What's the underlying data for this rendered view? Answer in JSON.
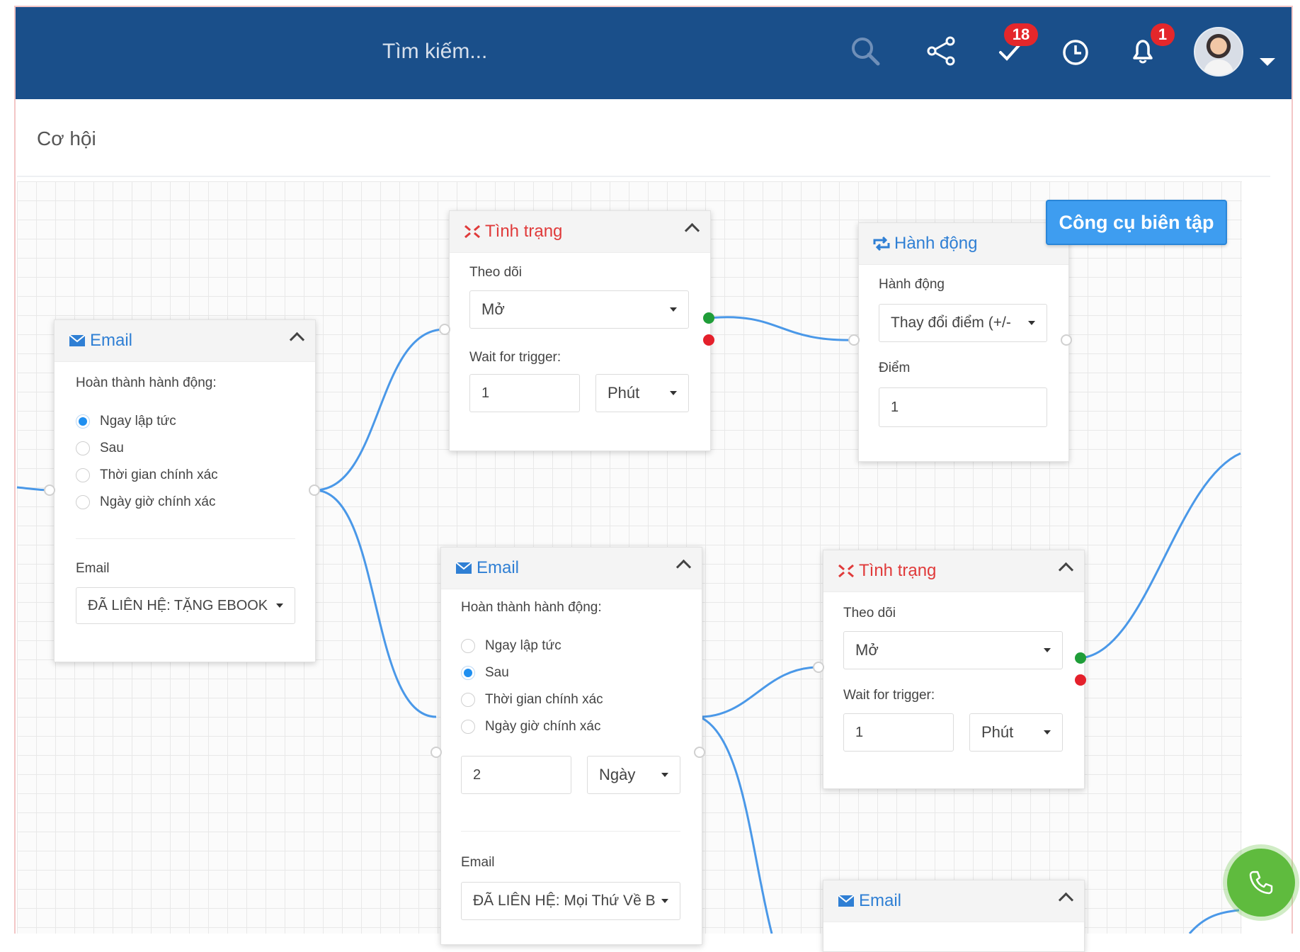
{
  "header": {
    "search_placeholder": "Tìm kiếm...",
    "tasks_badge": "18",
    "notifications_badge": "1",
    "bg_color": "#1a4f8a"
  },
  "page": {
    "title": "Cơ hội"
  },
  "toolbar": {
    "editor_button": "Công cụ biên tập"
  },
  "nodes": {
    "email1": {
      "title": "Email",
      "complete_label": "Hoàn thành hành động:",
      "options": [
        "Ngay lập tức",
        "Sau",
        "Thời gian chính xác",
        "Ngày giờ chính xác"
      ],
      "selected_option": "Ngay lập tức",
      "email_label": "Email",
      "email_value": "ĐÃ LIÊN HỆ: TẶNG EBOOK"
    },
    "status1": {
      "title": "Tình trạng",
      "track_label": "Theo dõi",
      "track_value": "Mở",
      "wait_label": "Wait for trigger:",
      "wait_amount": "1",
      "wait_unit": "Phút"
    },
    "action1": {
      "title": "Hành động",
      "action_label": "Hành động",
      "action_value": "Thay đổi điểm (+/-",
      "points_label": "Điểm",
      "points_value": "1"
    },
    "email2": {
      "title": "Email",
      "complete_label": "Hoàn thành hành động:",
      "options": [
        "Ngay lập tức",
        "Sau",
        "Thời gian chính xác",
        "Ngày giờ chính xác"
      ],
      "selected_option": "Sau",
      "delay_amount": "2",
      "delay_unit": "Ngày",
      "email_label": "Email",
      "email_value": "ĐÃ LIÊN HỆ: Mọi Thứ Về B"
    },
    "status2": {
      "title": "Tình trạng",
      "track_label": "Theo dõi",
      "track_value": "Mở",
      "wait_label": "Wait for trigger:",
      "wait_amount": "1",
      "wait_unit": "Phút"
    },
    "email3": {
      "title": "Email"
    }
  },
  "colors": {
    "accent_blue": "#2f7fd4",
    "status_red": "#e03a3a",
    "port_green": "#1f9d38",
    "port_red": "#e4202b",
    "wire": "#4a98e8",
    "phone_green": "#5fbb3e"
  },
  "icons": [
    "search-icon",
    "share-icon",
    "check-icon",
    "clock-icon",
    "bell-icon",
    "email-icon",
    "status-icon",
    "action-icon",
    "phone-icon"
  ]
}
